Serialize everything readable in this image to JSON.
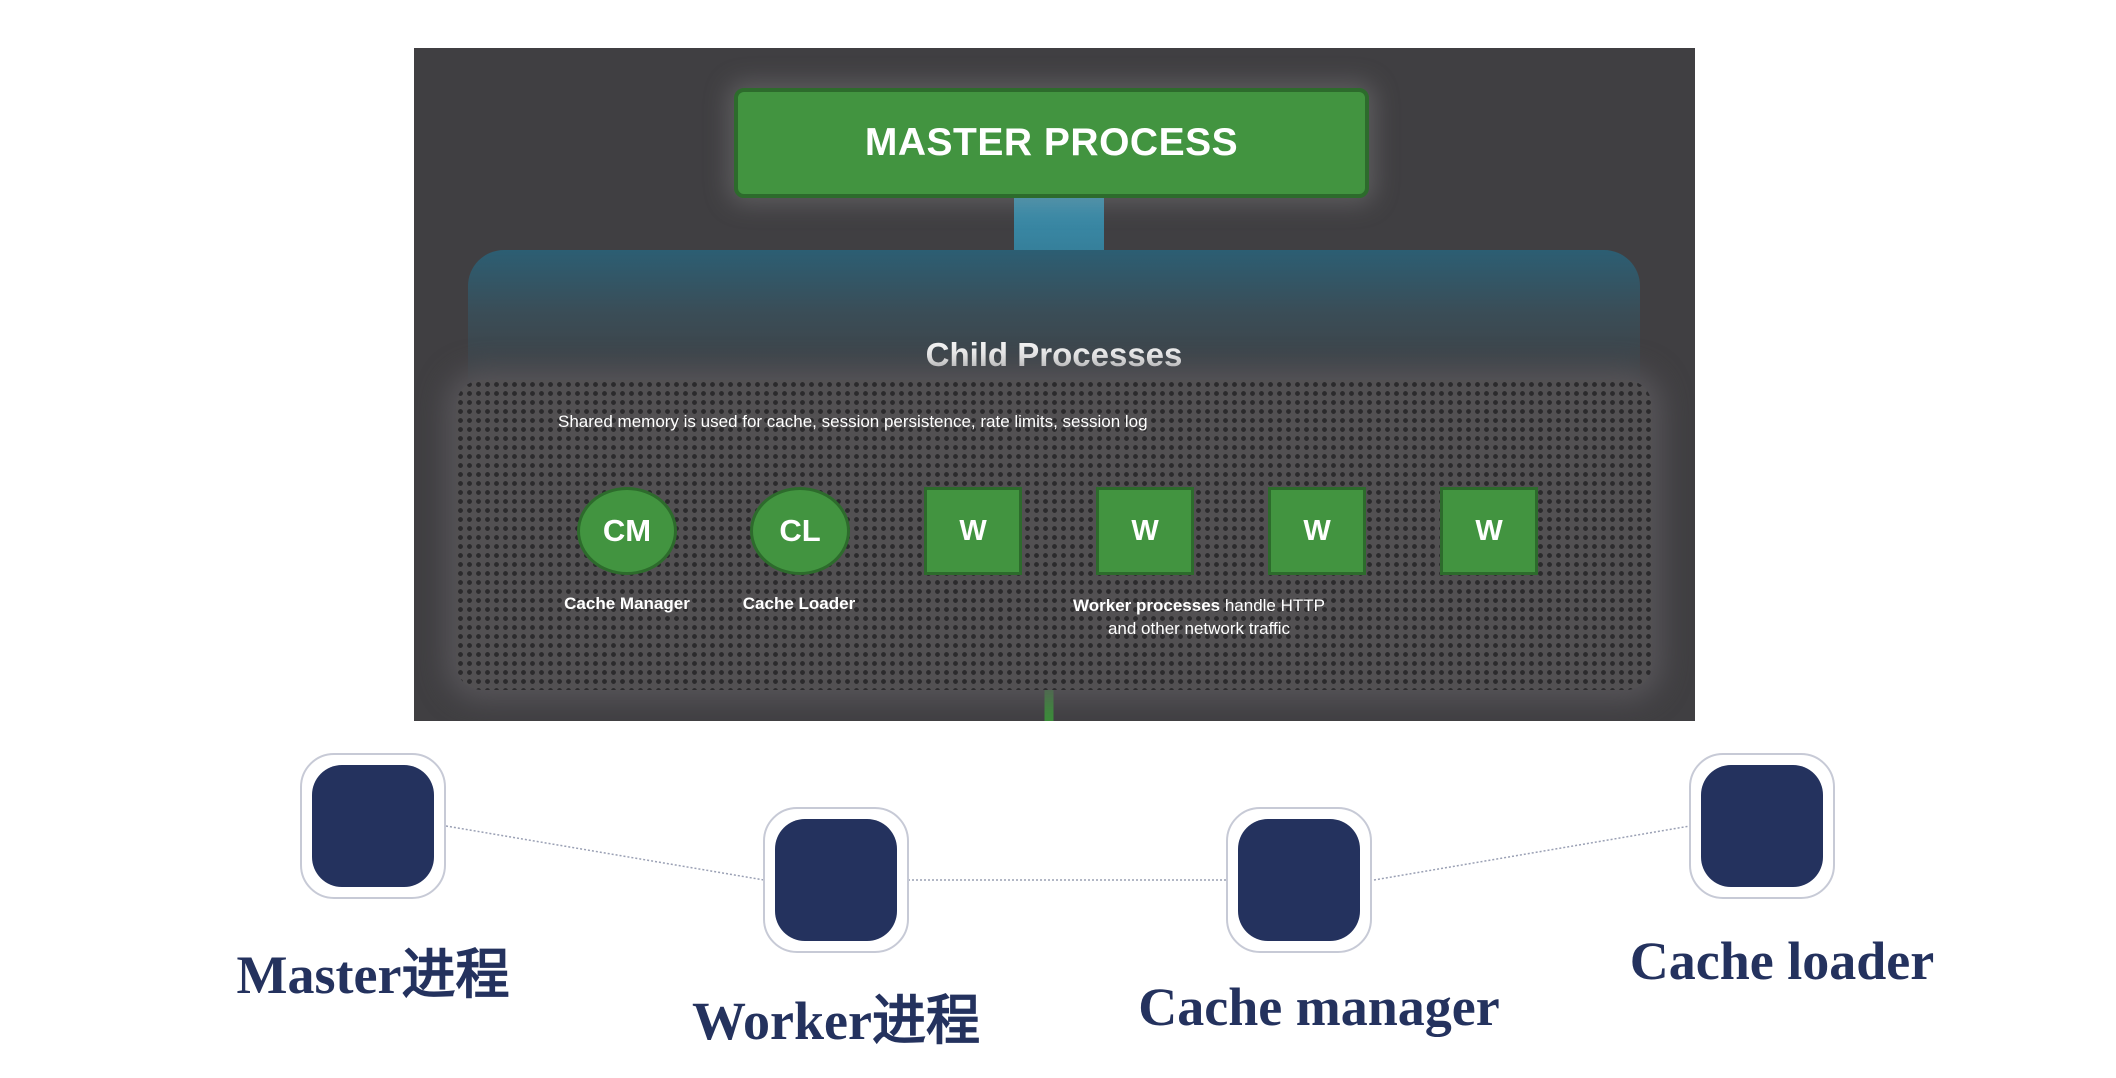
{
  "diagram": {
    "master_label": "MASTER PROCESS",
    "child_title": "Child Processes",
    "shared_memory_note": "Shared memory is used for cache, session persistence, rate limits, session log",
    "nodes": [
      {
        "label": "CM",
        "caption": "Cache Manager",
        "shape": "circle"
      },
      {
        "label": "CL",
        "caption": "Cache Loader",
        "shape": "circle"
      },
      {
        "label": "W",
        "shape": "square"
      },
      {
        "label": "W",
        "shape": "square"
      },
      {
        "label": "W",
        "shape": "square"
      },
      {
        "label": "W",
        "shape": "square"
      }
    ],
    "worker_caption_bold": "Worker processes",
    "worker_caption_rest": " handle HTTP",
    "worker_caption_line2": "and other network traffic",
    "colors": {
      "panel": "#403f42",
      "node_green": "#429440",
      "connector_blue": "#3c8fad"
    }
  },
  "timeline": {
    "steps": [
      {
        "label": "Master进程"
      },
      {
        "label": "Worker进程"
      },
      {
        "label": "Cache manager"
      },
      {
        "label": "Cache loader"
      }
    ],
    "colors": {
      "tile": "#24325e",
      "ring": "#c7cad6",
      "text": "#24325e"
    }
  }
}
